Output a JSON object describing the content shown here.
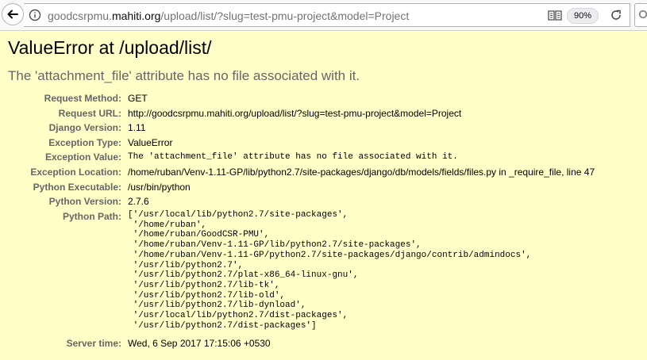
{
  "browser": {
    "url_prefix": "goodcsrpmu.",
    "url_domain": "mahiti.org",
    "url_path": "/upload/list/?slug=test-pmu-project&model=Project",
    "zoom": "90%"
  },
  "error": {
    "title": "ValueError at /upload/list/",
    "subtitle": "The 'attachment_file' attribute has no file associated with it."
  },
  "meta": {
    "request_method": {
      "label": "Request Method:",
      "value": "GET"
    },
    "request_url": {
      "label": "Request URL:",
      "value": "http://goodcsrpmu.mahiti.org/upload/list/?slug=test-pmu-project&model=Project"
    },
    "django_version": {
      "label": "Django Version:",
      "value": "1.11"
    },
    "exception_type": {
      "label": "Exception Type:",
      "value": "ValueError"
    },
    "exception_value": {
      "label": "Exception Value:",
      "value": "The 'attachment_file' attribute has no file associated with it."
    },
    "exception_location": {
      "label": "Exception Location:",
      "value": "/home/ruban/Venv-1.11-GP/lib/python2.7/site-packages/django/db/models/fields/files.py in _require_file, line 47"
    },
    "python_executable": {
      "label": "Python Executable:",
      "value": "/usr/bin/python"
    },
    "python_version": {
      "label": "Python Version:",
      "value": "2.7.6"
    },
    "python_path_label": "Python Path:",
    "python_path": [
      "['/usr/local/lib/python2.7/site-packages',",
      " '/home/ruban',",
      " '/home/ruban/GoodCSR-PMU',",
      " '/home/ruban/Venv-1.11-GP/lib/python2.7/site-packages',",
      " '/home/ruban/Venv-1.11-GP/python2.7/site-packages/django/contrib/admindocs',",
      " '/usr/lib/python2.7',",
      " '/usr/lib/python2.7/plat-x86_64-linux-gnu',",
      " '/usr/lib/python2.7/lib-tk',",
      " '/usr/lib/python2.7/lib-old',",
      " '/usr/lib/python2.7/lib-dynload',",
      " '/usr/local/lib/python2.7/dist-packages',",
      " '/usr/lib/python2.7/dist-packages']"
    ],
    "server_time": {
      "label": "Server time:",
      "value": "Wed, 6 Sep 2017 17:15:06 +0530"
    }
  },
  "colors": {
    "page_background": "#ffffc8",
    "label": "#666666",
    "subtitle": "#666666"
  },
  "icons": [
    "back-arrow-icon",
    "info-icon",
    "reader-view-icon",
    "reload-icon",
    "search-icon"
  ]
}
